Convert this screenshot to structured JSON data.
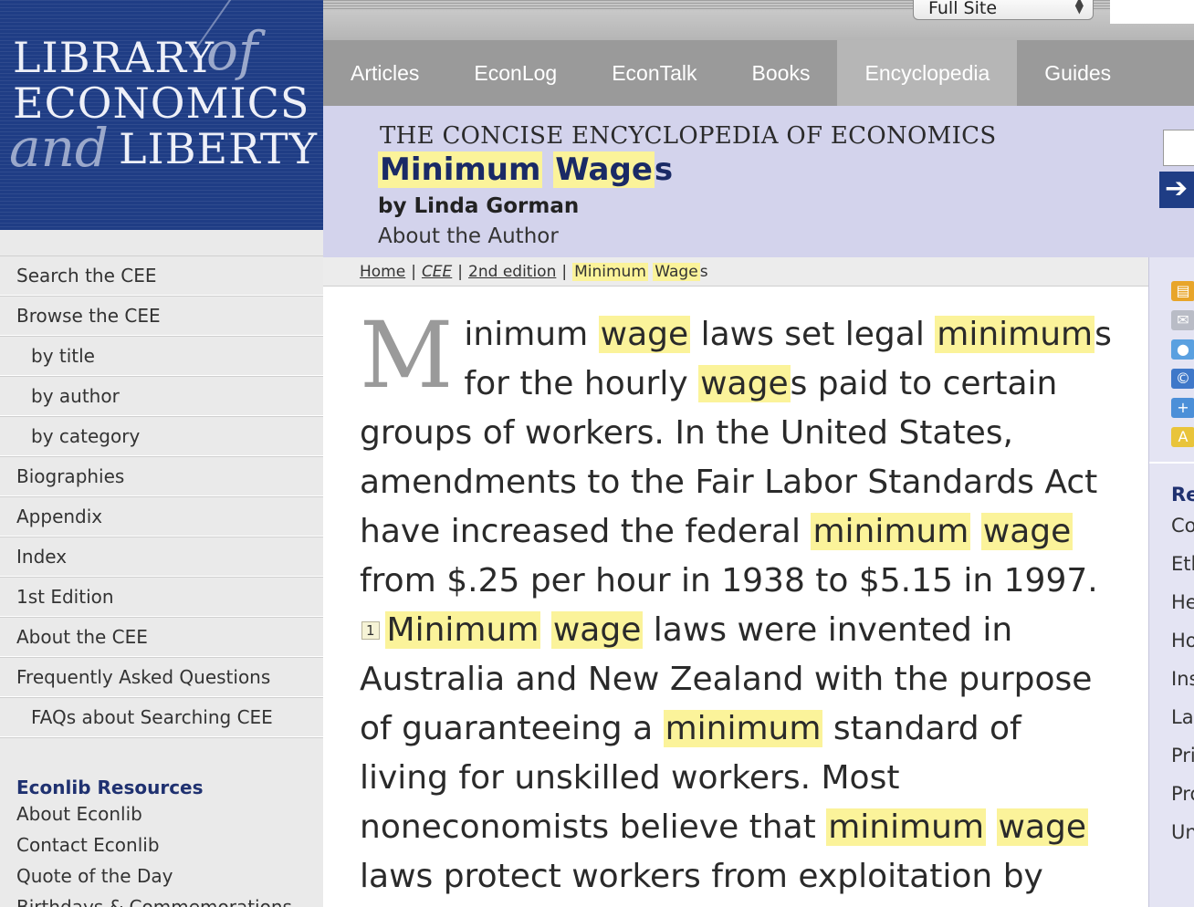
{
  "logo": {
    "line1": "LIBRARY",
    "line2": "ECONOMICS",
    "line3": "LIBERTY",
    "script_of": "of",
    "script_and": "and"
  },
  "site_select": {
    "value": "Full Site"
  },
  "nav": [
    "Articles",
    "EconLog",
    "EconTalk",
    "Books",
    "Encyclopedia",
    "Guides"
  ],
  "nav_active": "Encyclopedia",
  "header": {
    "cee_title": "THE CONCISE ENCYCLOPEDIA OF ECONOMICS",
    "title_word1": "Minimum",
    "title_word2": "Wage",
    "title_suffix": "s",
    "author": "by Linda Gorman",
    "about_author": "About the Author",
    "go_arrow": "➔"
  },
  "sidebar": {
    "items": [
      {
        "label": "Search the CEE",
        "sub": false
      },
      {
        "label": "Browse the CEE",
        "sub": false
      },
      {
        "label": "by title",
        "sub": true
      },
      {
        "label": "by author",
        "sub": true
      },
      {
        "label": "by category",
        "sub": true
      },
      {
        "label": "Biographies",
        "sub": false
      },
      {
        "label": "Appendix",
        "sub": false
      },
      {
        "label": "Index",
        "sub": false
      },
      {
        "label": "1st Edition",
        "sub": false
      },
      {
        "label": "About the CEE",
        "sub": false
      },
      {
        "label": "Frequently Asked Questions",
        "sub": false
      },
      {
        "label": "FAQs about Searching CEE",
        "sub": true
      }
    ],
    "resources_heading": "Econlib Resources",
    "resources": [
      "About Econlib",
      "Contact Econlib",
      "Quote of the Day",
      "Birthdays & Commemorations"
    ]
  },
  "breadcrumb": {
    "home": "Home",
    "cee": "CEE",
    "edition": "2nd edition",
    "current_word1": "Minimum",
    "current_word2": "Wage",
    "current_suffix": "s",
    "separator": "|"
  },
  "article": {
    "dropcap": "M",
    "footnote": "1",
    "segments": [
      {
        "t": "inimum "
      },
      {
        "t": "wage",
        "h": true
      },
      {
        "t": " laws set legal "
      },
      {
        "t": "minimum",
        "h": true
      },
      {
        "t": "s for the hourly "
      },
      {
        "t": "wage",
        "h": true
      },
      {
        "t": "s paid to certain groups of workers. In the United States, amendments to the Fair Labor Standards Act have increased the federal "
      },
      {
        "t": "minimum",
        "h": true
      },
      {
        "t": " "
      },
      {
        "t": "wage",
        "h": true
      },
      {
        "t": " from $.25 per hour in 1938 to $5.15 in 1997."
      },
      {
        "fn": true
      },
      {
        "t": "Minimum",
        "h": true
      },
      {
        "t": " "
      },
      {
        "t": "wage",
        "h": true
      },
      {
        "t": " laws were invented in Australia and New Zealand with the purpose of guaranteeing a "
      },
      {
        "t": "minimum",
        "h": true
      },
      {
        "t": " standard of living for unskilled workers. Most noneconomists believe that "
      },
      {
        "t": "minimum",
        "h": true
      },
      {
        "t": " "
      },
      {
        "t": "wage",
        "h": true
      },
      {
        "t": " laws protect workers from exploitation by employers and"
      }
    ]
  },
  "right_rail": {
    "tools": [
      {
        "icon": "printer-icon",
        "color": "#e8a52a"
      },
      {
        "icon": "email-icon",
        "color": "#b9bcc6"
      },
      {
        "icon": "comment-icon",
        "color": "#5aa0e0"
      },
      {
        "icon": "copyright-icon",
        "color": "#3f78c9"
      },
      {
        "icon": "add-icon",
        "color": "#4b8fd8"
      },
      {
        "icon": "font-size-icon",
        "color": "#e9c43a"
      }
    ],
    "heading": "Re",
    "links": [
      "Co",
      "Etl",
      "He",
      "Ho",
      "Ins",
      "La",
      "Pri",
      "Pro",
      "Un"
    ]
  }
}
